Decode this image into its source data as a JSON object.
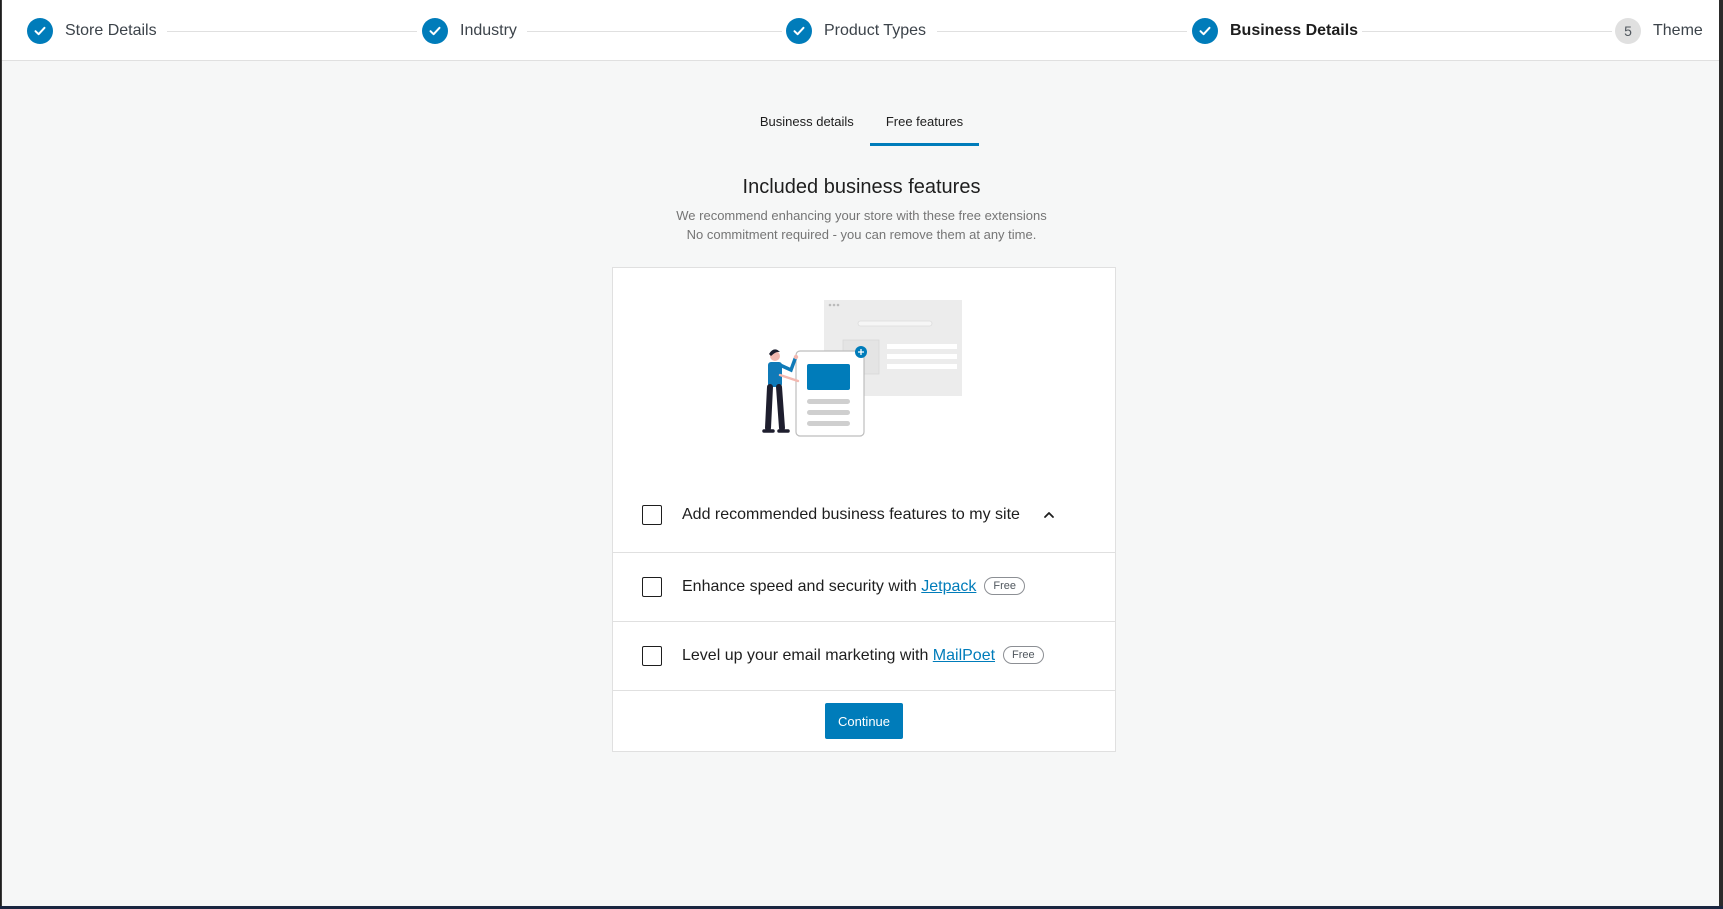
{
  "stepper": {
    "steps": [
      {
        "label": "Store Details",
        "state": "done"
      },
      {
        "label": "Industry",
        "state": "done"
      },
      {
        "label": "Product Types",
        "state": "done"
      },
      {
        "label": "Business Details",
        "state": "current"
      },
      {
        "label": "Theme",
        "state": "pending",
        "number": "5"
      }
    ]
  },
  "tabs": [
    {
      "label": "Business details",
      "active": false
    },
    {
      "label": "Free features",
      "active": true
    }
  ],
  "heading": "Included business features",
  "subtext": [
    "We recommend enhancing your store with these free extensions",
    "No commitment required - you can remove them at any time."
  ],
  "card": {
    "master_option": {
      "label": "Add recommended business features to my site",
      "checked": false,
      "icon": "chevron-up-icon"
    },
    "options": [
      {
        "prefix": "Enhance speed and security with ",
        "link": "Jetpack",
        "badge": "Free",
        "checked": false
      },
      {
        "prefix": "Level up your email marketing with ",
        "link": "MailPoet",
        "badge": "Free",
        "checked": false
      }
    ],
    "continue_label": "Continue"
  },
  "colors": {
    "accent": "#007cba",
    "background": "#f6f7f7",
    "card": "#ffffff",
    "border": "#e0e0e0",
    "muted_text": "#757575"
  }
}
